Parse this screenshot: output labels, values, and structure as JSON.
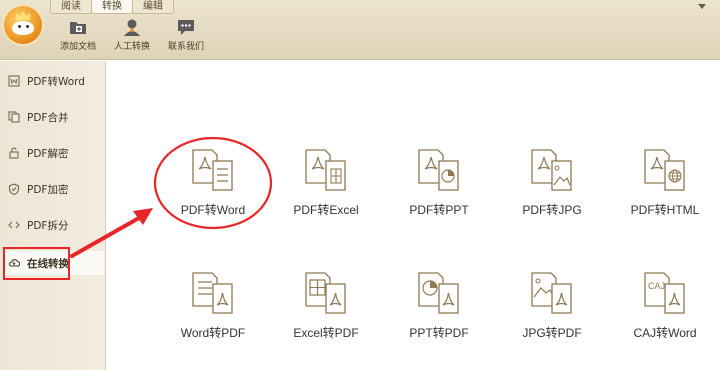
{
  "tabs": [
    {
      "label": "阅读"
    },
    {
      "label": "转换"
    },
    {
      "label": "编辑"
    }
  ],
  "toolbar": [
    {
      "label": "添加文档",
      "icon": "add-document-icon"
    },
    {
      "label": "人工转换",
      "icon": "person-icon"
    },
    {
      "label": "联系我们",
      "icon": "chat-icon"
    }
  ],
  "sidebar": {
    "items": [
      {
        "label": "PDF转Word",
        "icon": "word-icon"
      },
      {
        "label": "PDF合并",
        "icon": "merge-icon"
      },
      {
        "label": "PDF解密",
        "icon": "unlock-icon"
      },
      {
        "label": "PDF加密",
        "icon": "shield-icon"
      },
      {
        "label": "PDF拆分",
        "icon": "split-icon"
      },
      {
        "label": "在线转换",
        "icon": "cloud-icon"
      }
    ],
    "active_index": 5
  },
  "converters": [
    {
      "label": "PDF转Word",
      "icon": "pdf-to-word-icon"
    },
    {
      "label": "PDF转Excel",
      "icon": "pdf-to-excel-icon"
    },
    {
      "label": "PDF转PPT",
      "icon": "pdf-to-ppt-icon"
    },
    {
      "label": "PDF转JPG",
      "icon": "pdf-to-jpg-icon"
    },
    {
      "label": "PDF转HTML",
      "icon": "pdf-to-html-icon"
    },
    {
      "label": "Word转PDF",
      "icon": "word-to-pdf-icon"
    },
    {
      "label": "Excel转PDF",
      "icon": "excel-to-pdf-icon"
    },
    {
      "label": "PPT转PDF",
      "icon": "ppt-to-pdf-icon"
    },
    {
      "label": "JPG转PDF",
      "icon": "jpg-to-pdf-icon"
    },
    {
      "label": "CAJ转Word",
      "icon": "caj-to-word-icon"
    }
  ],
  "caj_text": "CAJ",
  "colors": {
    "annotation": "#e8262a",
    "icon_stroke": "#8f7a55",
    "accent": "#e88a1a"
  }
}
